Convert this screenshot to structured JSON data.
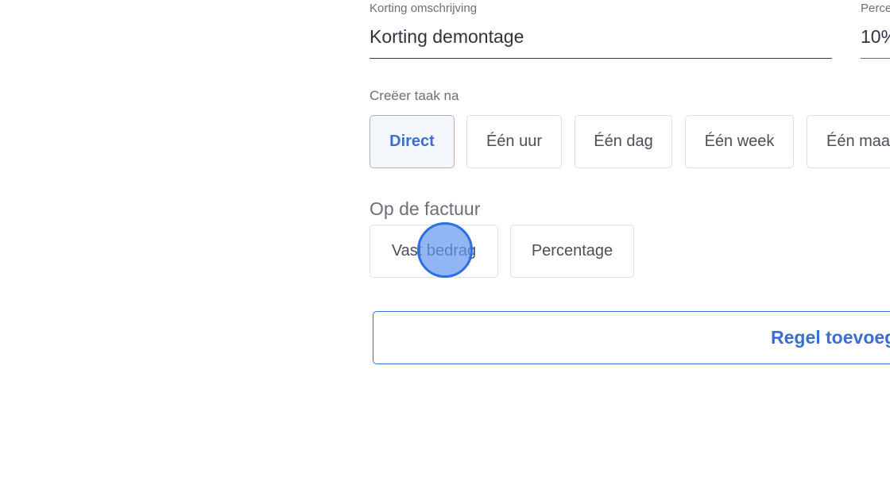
{
  "discount_description": {
    "label": "Korting omschrijving",
    "value": "Korting demontage"
  },
  "percentage_field": {
    "label": "Perce",
    "value": "10%"
  },
  "task_timing": {
    "label": "Creëer taak na",
    "options": [
      "Direct",
      "Één uur",
      "Één dag",
      "Één week",
      "Één maa"
    ],
    "selected": "Direct"
  },
  "invoice": {
    "label": "Op de factuur",
    "options": [
      "Vast bedrag",
      "Percentage"
    ]
  },
  "add_rule_button": {
    "label": "Regel toevoeg"
  },
  "colors": {
    "accent": "#3a6fd1",
    "selected_bg": "#f4f7fc",
    "border": "#dcdfe5",
    "click_indicator": "#2c6fe0"
  }
}
